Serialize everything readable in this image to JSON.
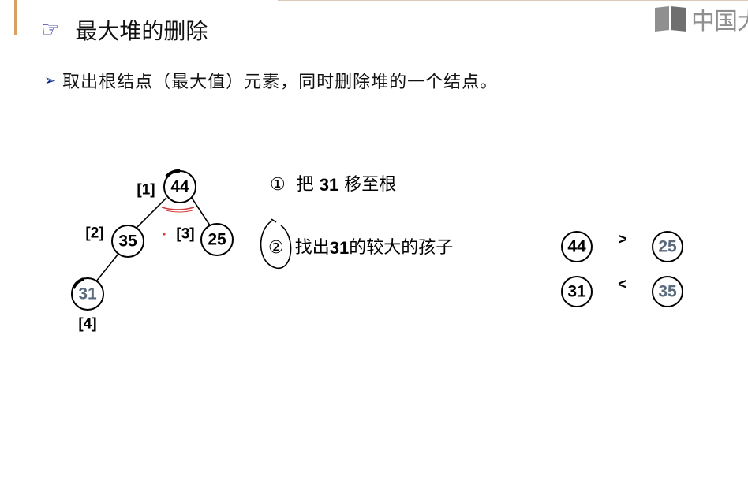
{
  "header": {
    "pointer_icon": "pointing-hand-icon",
    "title": "最大堆的删除",
    "watermark": "中国大",
    "watermark_icon": "book-icon"
  },
  "bullet": {
    "icon": "triangle-arrow-icon",
    "text": "取出根结点（最大值）元素，同时删除堆的一个结点。"
  },
  "tree": {
    "nodes": [
      {
        "index": "[1]",
        "value": "44",
        "color": "#000000"
      },
      {
        "index": "[2]",
        "value": "35",
        "color": "#000000"
      },
      {
        "index": "[3]",
        "value": "25",
        "color": "#000000"
      },
      {
        "index": "[4]",
        "value": "31",
        "color": "#5a6b7d"
      }
    ]
  },
  "steps": [
    {
      "marker": "①",
      "prefix": "把 ",
      "bold": "31",
      "suffix": " 移至根"
    },
    {
      "marker": "②",
      "prefix": "找出",
      "bold": "31",
      "suffix": "的较大的孩子"
    }
  ],
  "comparisons": [
    {
      "left": "44",
      "left_color": "#000000",
      "op": ">",
      "right": "25",
      "right_color": "#5a6b7d"
    },
    {
      "left": "31",
      "left_color": "#000000",
      "op": "<",
      "right": "35",
      "right_color": "#5a6b7d"
    }
  ],
  "colors": {
    "annotation_red": "#d23b3b",
    "muted_node_text": "#5a6b7d",
    "bullet_blue": "#0b2a8c",
    "accent_bar": "#d9a066"
  }
}
